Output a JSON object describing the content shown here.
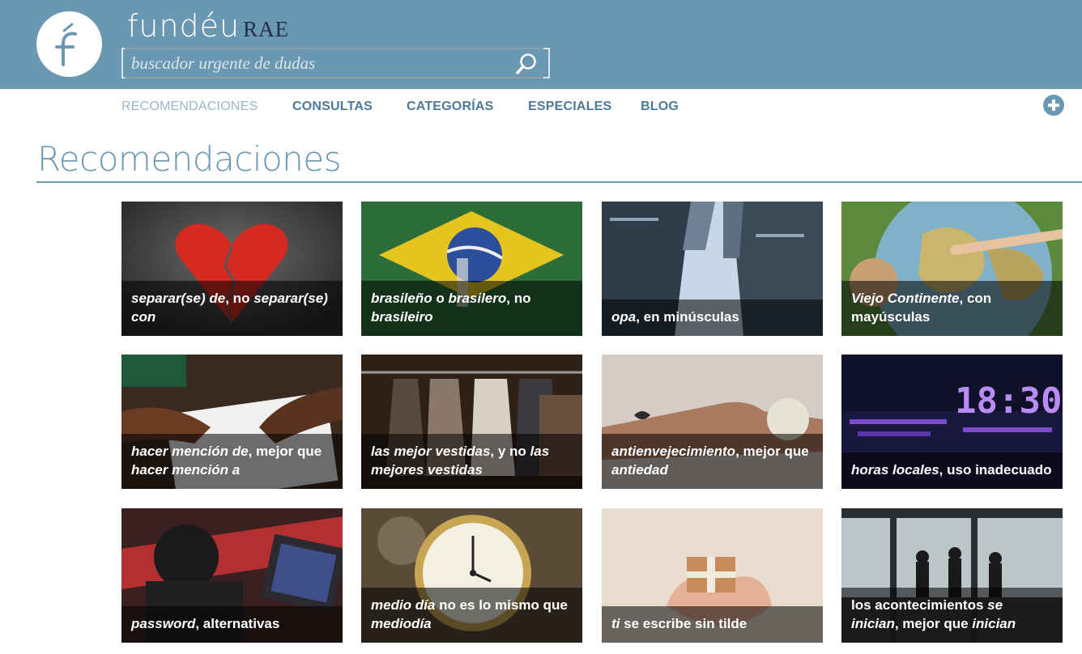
{
  "header": {
    "brand_main": "fundéu",
    "brand_sub": "RAE",
    "logo_icon": "fundeu-logo-icon",
    "search_placeholder": "buscador urgente de dudas",
    "colors": {
      "header_bg": "#6a98b2",
      "brand_dark": "#1f2e4a"
    }
  },
  "nav": {
    "items": [
      {
        "label": "RECOMENDACIONES",
        "active": true
      },
      {
        "label": "CONSULTAS",
        "active": false
      },
      {
        "label": "CATEGORÍAS",
        "active": false
      },
      {
        "label": "ESPECIALES",
        "active": false
      },
      {
        "label": "BLOG",
        "active": false
      }
    ],
    "plus_icon": "plus-circle-icon"
  },
  "main": {
    "title": "Recomendaciones",
    "cards": [
      {
        "parts": [
          {
            "t": "separar(se) de",
            "i": true
          },
          {
            "t": ", no ",
            "i": false
          },
          {
            "t": "separar(se) con",
            "i": true
          }
        ],
        "image": "broken heart"
      },
      {
        "parts": [
          {
            "t": "brasileño",
            "i": true
          },
          {
            "t": " o ",
            "i": false
          },
          {
            "t": "brasilero",
            "i": true
          },
          {
            "t": ", no ",
            "i": false
          },
          {
            "t": "brasileiro",
            "i": true
          }
        ],
        "image": "brazil flag mural"
      },
      {
        "parts": [
          {
            "t": "opa",
            "i": true
          },
          {
            "t": ", en minúsculas",
            "i": false
          }
        ],
        "image": "skyscrapers"
      },
      {
        "parts": [
          {
            "t": "Viejo Continente",
            "i": true
          },
          {
            "t": ", con mayúsculas",
            "i": false
          }
        ],
        "image": "globe"
      },
      {
        "parts": [
          {
            "t": "hacer mención de",
            "i": true
          },
          {
            "t": ", mejor que ",
            "i": false
          },
          {
            "t": "hacer mención a",
            "i": true
          }
        ],
        "image": "hands on documents"
      },
      {
        "parts": [
          {
            "t": "las mejor vestidas",
            "i": true
          },
          {
            "t": ", y no ",
            "i": false
          },
          {
            "t": "las mejores vestidas",
            "i": true
          }
        ],
        "image": "clothes rack"
      },
      {
        "parts": [
          {
            "t": "antienvejecimiento",
            "i": true
          },
          {
            "t": ", mejor que ",
            "i": false
          },
          {
            "t": "antiedad",
            "i": true
          }
        ],
        "image": "hand with cream"
      },
      {
        "parts": [
          {
            "t": "horas locales",
            "i": true
          },
          {
            "t": ", uso inadecuado",
            "i": false
          }
        ],
        "image": "digital clock 18:30"
      },
      {
        "parts": [
          {
            "t": "password",
            "i": true
          },
          {
            "t": ", alternativas",
            "i": false
          }
        ],
        "image": "tablet unlock"
      },
      {
        "parts": [
          {
            "t": "medio día",
            "i": true
          },
          {
            "t": " no es lo mismo que ",
            "i": false
          },
          {
            "t": "mediodía",
            "i": true
          }
        ],
        "image": "pocket watch"
      },
      {
        "parts": [
          {
            "t": "ti",
            "i": true
          },
          {
            "t": " se escribe sin tilde",
            "i": false
          }
        ],
        "image": "gift in hands"
      },
      {
        "parts": [
          {
            "t": "los acontecimientos ",
            "i": false
          },
          {
            "t": "se inician",
            "i": true
          },
          {
            "t": ", mejor que ",
            "i": false
          },
          {
            "t": "inician",
            "i": true
          }
        ],
        "image": "airport silhouettes"
      }
    ]
  }
}
